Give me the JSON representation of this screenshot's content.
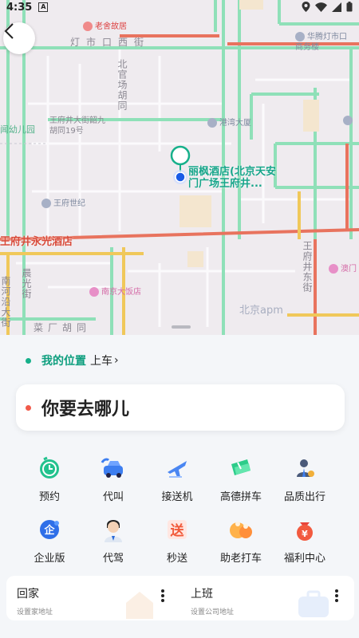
{
  "status_bar": {
    "time": "4:35",
    "notif_letter": "A"
  },
  "map": {
    "labels": {
      "dengshikou": "灯市口西街",
      "beiguanchang": "北官场胡同",
      "wangfujing_19": "王府井大街韶九胡同19号",
      "laoshe": "老舍故居",
      "huateng": "华腾灯市口商务楼",
      "gangwan": "港湾大厦",
      "wangfu_century": "王府世纪",
      "wangfu_east": "王府井东街",
      "nanjing_hotel": "南京大饭店",
      "beijing_apm": "北京apm",
      "caichang": "菜厂胡同",
      "chenguang": "晨光街",
      "nanheyan": "南河沿大街",
      "youeryuan": "闻幼儿园",
      "ao": "澳门",
      "hotel": "丽枫酒店(北京天安门广场王府井...",
      "road": "王府井永光酒店"
    }
  },
  "panel": {
    "location": {
      "name": "我的位置",
      "action": "上车",
      "chevron": "›"
    },
    "destination_placeholder": "你要去哪儿",
    "services": [
      {
        "label": "预约",
        "icon": "clock-icon"
      },
      {
        "label": "代叫",
        "icon": "phone-car-icon"
      },
      {
        "label": "接送机",
        "icon": "airplane-icon"
      },
      {
        "label": "高德拼车",
        "icon": "carpool-icon"
      },
      {
        "label": "品质出行",
        "icon": "business-person-icon"
      },
      {
        "label": "企业版",
        "icon": "enterprise-icon"
      },
      {
        "label": "代驾",
        "icon": "driver-avatar-icon"
      },
      {
        "label": "秒送",
        "icon": "express-delivery-icon"
      },
      {
        "label": "助老打车",
        "icon": "elderly-assist-icon"
      },
      {
        "label": "福利中心",
        "icon": "welfare-bag-icon"
      }
    ],
    "places": [
      {
        "title": "回家",
        "subtitle": "设置家地址"
      },
      {
        "title": "上班",
        "subtitle": "设置公司地址"
      }
    ]
  },
  "colors": {
    "accent": "#16b08a",
    "dest_dot": "#f15a4a",
    "road_red": "#e8735e",
    "road_green": "#8fe0b8"
  }
}
